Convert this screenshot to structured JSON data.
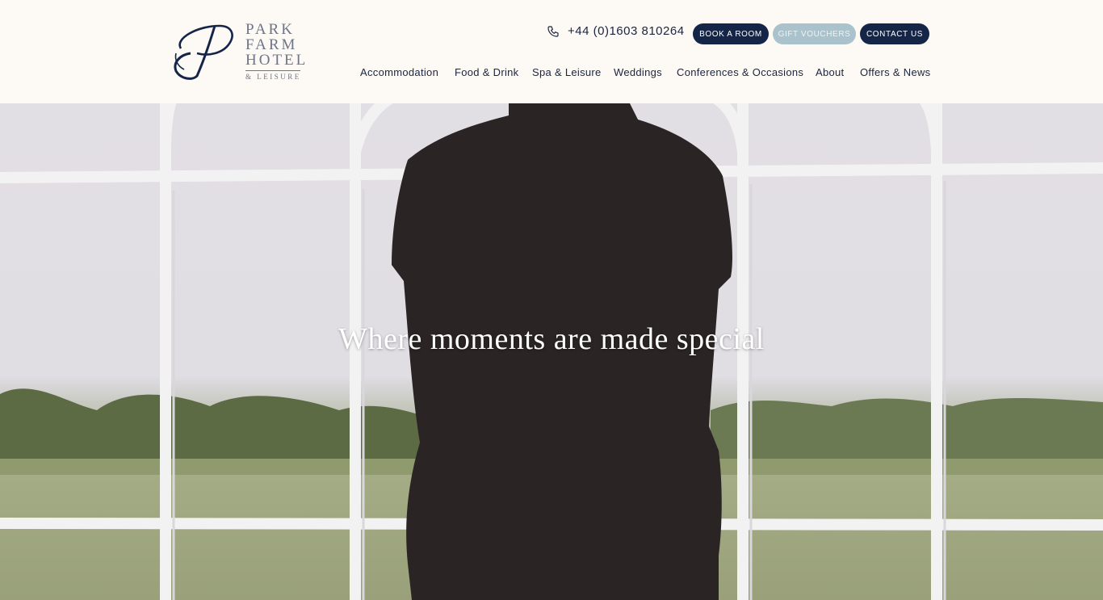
{
  "header": {
    "logo": {
      "line1": "PARK",
      "line2": "FARM",
      "line3": "HOTEL",
      "line4": "& LEISURE"
    },
    "phone": {
      "icon": "phone-icon",
      "number": "+44 (0)1603 810264"
    },
    "buttons": {
      "book": "BOOK A ROOM",
      "gift": "GIFT VOUCHERS",
      "contact": "CONTACT US"
    },
    "nav": [
      "Accommodation",
      "Food & Drink",
      "Spa & Leisure",
      "Weddings",
      "Conferences & Occasions",
      "About",
      "Offers & News"
    ]
  },
  "hero": {
    "headline": "Where moments are made special"
  },
  "colors": {
    "navy": "#142548",
    "gift_button": "#a9c2cc",
    "header_bg": "#fdf9f5",
    "logo_grey": "#6d7588"
  }
}
